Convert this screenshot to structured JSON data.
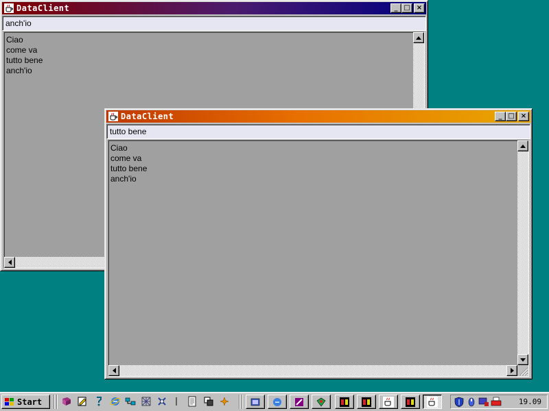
{
  "windows": {
    "back": {
      "title": "DataClient",
      "input_value": "anch'io",
      "lines": [
        "Ciao",
        "come va",
        "tutto bene",
        "anch'io"
      ]
    },
    "front": {
      "title": "DataClient",
      "input_value": "tutto bene",
      "lines": [
        "Ciao",
        "come va",
        "tutto bene",
        "anch'io"
      ]
    }
  },
  "title_buttons": {
    "minimize": "_",
    "maximize": "□",
    "close": "×"
  },
  "taskbar": {
    "start_label": "Start",
    "clock": "19.09",
    "quick_launch": [
      "book-icon",
      "notepad-icon",
      "help-icon",
      "ie-icon",
      "network-icon",
      "grid-icon",
      "tools-icon",
      "pen-icon",
      "document-icon",
      "web-tool-icon",
      "sparkle-icon"
    ],
    "tasks": [
      {
        "icon": "explorer-icon",
        "active": false
      },
      {
        "icon": "browser-icon",
        "active": false
      },
      {
        "icon": "editor-icon",
        "active": false
      },
      {
        "icon": "paint-icon",
        "active": false
      },
      {
        "icon": "dos-icon",
        "active": false
      },
      {
        "icon": "dos-icon",
        "active": false
      },
      {
        "icon": "java-icon",
        "active": false
      },
      {
        "icon": "dos-icon",
        "active": false
      },
      {
        "icon": "java-icon",
        "active": true
      }
    ],
    "tray": [
      "shield-icon",
      "volume-icon",
      "monitor-icon",
      "printer-icon"
    ]
  },
  "colors": {
    "desktop": "#008080",
    "inactive_title_start": "#800000",
    "inactive_title_end": "#000080",
    "active_title_start": "#c03800",
    "active_title_end": "#e8a800"
  }
}
